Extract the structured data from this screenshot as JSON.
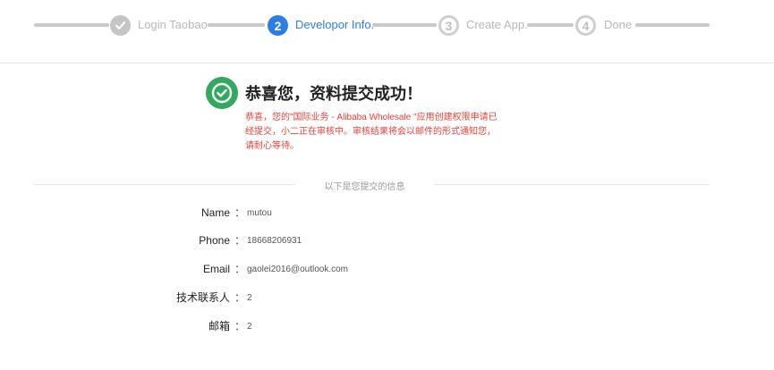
{
  "steps": [
    {
      "label": "Login Taobao",
      "number": "",
      "icon": "check-icon"
    },
    {
      "label": "Developor Info.",
      "number": "2"
    },
    {
      "label": "Create App.",
      "number": "3"
    },
    {
      "label": "Done",
      "number": "4"
    }
  ],
  "colors": {
    "active": "#2d7ee4",
    "success": "#33a861",
    "alert": "#e8403b"
  },
  "success": {
    "icon": "check-circle-icon",
    "title": "恭喜您，资料提交成功！",
    "message": "恭喜，您的\"国际业务 - Alibaba Wholesale \"应用创建权限申请已经提交，小二正在审核中。审核结果将会以邮件的形式通知您，请耐心等待。"
  },
  "section": {
    "title": "以下是您提交的信息"
  },
  "info": [
    {
      "label": "Name",
      "colon": "：",
      "value": "mutou"
    },
    {
      "label": "Phone",
      "colon": "：",
      "value": "18668206931"
    },
    {
      "label": "Email",
      "colon": "：",
      "value": "gaolei2016@outlook.com"
    },
    {
      "label": "技术联系人",
      "colon": "：",
      "value": "2"
    },
    {
      "label": "邮箱",
      "colon": "：",
      "value": "2"
    }
  ]
}
